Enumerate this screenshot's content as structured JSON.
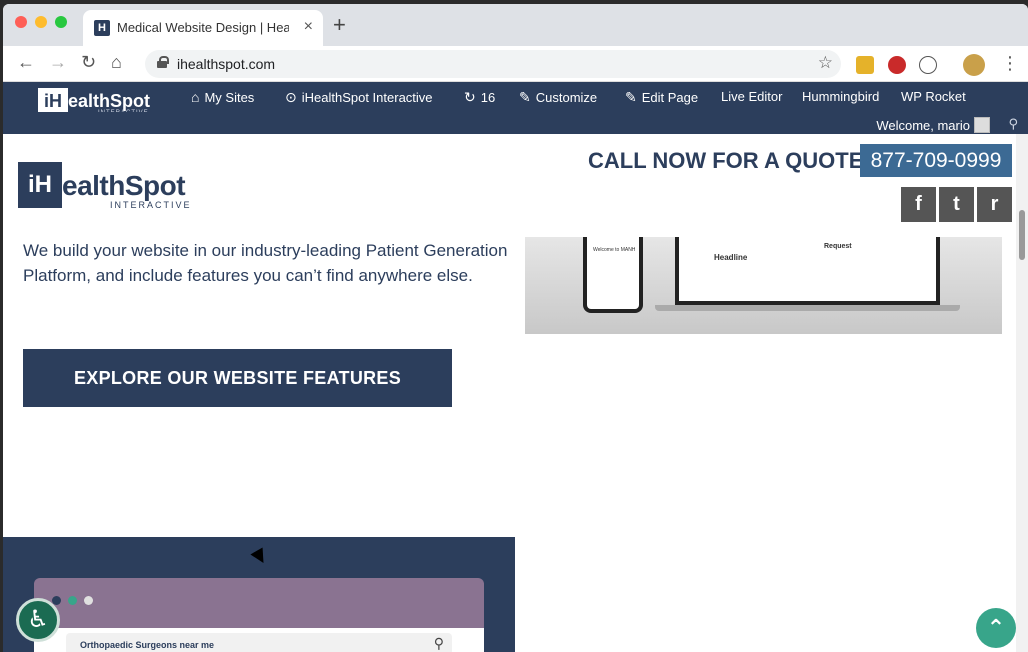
{
  "browser": {
    "tab_title": "Medical Website Design | Healt",
    "tab_favicon": "H",
    "close_glyph": "×",
    "new_tab_glyph": "+",
    "url": "ihealthspot.com",
    "back_glyph": "←",
    "forward_glyph": "→",
    "reload_glyph": "↻",
    "home_glyph": "⌂",
    "star_glyph": "☆",
    "menu_glyph": "⋮"
  },
  "adminbar": {
    "logo_letter": "iH",
    "logo_text": "ealthSpot",
    "logo_sub": "INTERACTIVE",
    "items": [
      {
        "icon": "⌂",
        "label": "My Sites"
      },
      {
        "icon": "⊙",
        "label": "iHealthSpot Interactive"
      },
      {
        "icon": "↻",
        "label": "16"
      },
      {
        "icon": "✎",
        "label": "Customize"
      },
      {
        "icon": "✎",
        "label": "Edit Page"
      },
      {
        "icon": "",
        "label": "Live Editor"
      },
      {
        "icon": "",
        "label": "Hummingbird"
      },
      {
        "icon": "",
        "label": "WP Rocket"
      }
    ],
    "welcome": "Welcome, mario",
    "search_glyph": "⚲"
  },
  "page": {
    "logo_letter": "iH",
    "logo_text": "ealthSpot",
    "logo_sub": "INTERACTIVE",
    "call_now": "CALL NOW FOR A QUOTE!",
    "phone": "877-709-0999",
    "social": [
      "f",
      "t",
      "r"
    ],
    "copy": "We build your website in our industry-leading Patient Generation Platform, and include features you can’t find anywhere else.",
    "cta": "EXPLORE OUR WEBSITE FEATURES",
    "mock_headline": "Headline",
    "mock_request": "Request",
    "mock_phone_text": "Welcome to MANH",
    "search_mock": "Orthopaedic Surgeons near me",
    "search_mock_glyph": "⚲",
    "access_glyph": "♿",
    "totop_glyph": "⌃"
  },
  "colors": {
    "brand_navy": "#2c3e5c",
    "phone_blue": "#3c6a94",
    "accent_green": "#38a58a"
  }
}
